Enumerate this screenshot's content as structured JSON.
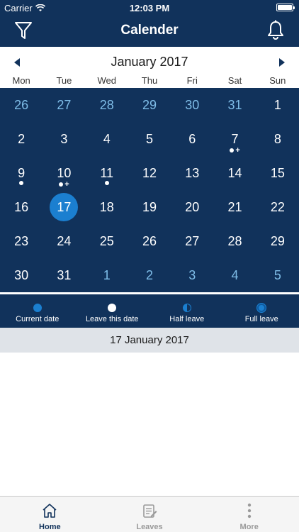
{
  "status_bar": {
    "carrier": "Carrier",
    "time": "12:03 PM"
  },
  "nav": {
    "title": "Calender",
    "left_icon": "filter-icon",
    "right_icon": "bell-icon"
  },
  "calendar": {
    "month_label": "January 2017",
    "weekdays": [
      "Mon",
      "Tue",
      "Wed",
      "Thu",
      "Fri",
      "Sat",
      "Sun"
    ],
    "days": [
      {
        "n": "26",
        "other": true
      },
      {
        "n": "27",
        "other": true
      },
      {
        "n": "28",
        "other": true
      },
      {
        "n": "29",
        "other": true
      },
      {
        "n": "30",
        "other": true
      },
      {
        "n": "31",
        "other": true
      },
      {
        "n": "1"
      },
      {
        "n": "2"
      },
      {
        "n": "3"
      },
      {
        "n": "4"
      },
      {
        "n": "5"
      },
      {
        "n": "6"
      },
      {
        "n": "7",
        "dot": true,
        "plus": true
      },
      {
        "n": "8"
      },
      {
        "n": "9",
        "dot": true
      },
      {
        "n": "10",
        "dot": true,
        "plus": true
      },
      {
        "n": "11",
        "dot": true
      },
      {
        "n": "12"
      },
      {
        "n": "13"
      },
      {
        "n": "14"
      },
      {
        "n": "15"
      },
      {
        "n": "16"
      },
      {
        "n": "17",
        "selected": true
      },
      {
        "n": "18"
      },
      {
        "n": "19"
      },
      {
        "n": "20"
      },
      {
        "n": "21"
      },
      {
        "n": "22"
      },
      {
        "n": "23"
      },
      {
        "n": "24"
      },
      {
        "n": "25"
      },
      {
        "n": "26"
      },
      {
        "n": "27"
      },
      {
        "n": "28"
      },
      {
        "n": "29"
      },
      {
        "n": "30"
      },
      {
        "n": "31"
      },
      {
        "n": "1",
        "other": true
      },
      {
        "n": "2",
        "other": true
      },
      {
        "n": "3",
        "other": true
      },
      {
        "n": "4",
        "other": true
      },
      {
        "n": "5",
        "other": true
      }
    ],
    "plus_sign": "+"
  },
  "legend": [
    {
      "label": "Current date",
      "kind": "current"
    },
    {
      "label": "Leave this date",
      "kind": "leave"
    },
    {
      "label": "Half leave",
      "kind": "half"
    },
    {
      "label": "Full leave",
      "kind": "full"
    }
  ],
  "selected_date": "17 January 2017",
  "tabs": [
    {
      "label": "Home",
      "icon": "home-icon",
      "active": true
    },
    {
      "label": "Leaves",
      "icon": "leaves-icon",
      "active": false
    },
    {
      "label": "More",
      "icon": "more-icon",
      "active": false
    }
  ],
  "colors": {
    "primary": "#11325b",
    "accent": "#1b7fd0",
    "other_month": "#7fbde8"
  }
}
